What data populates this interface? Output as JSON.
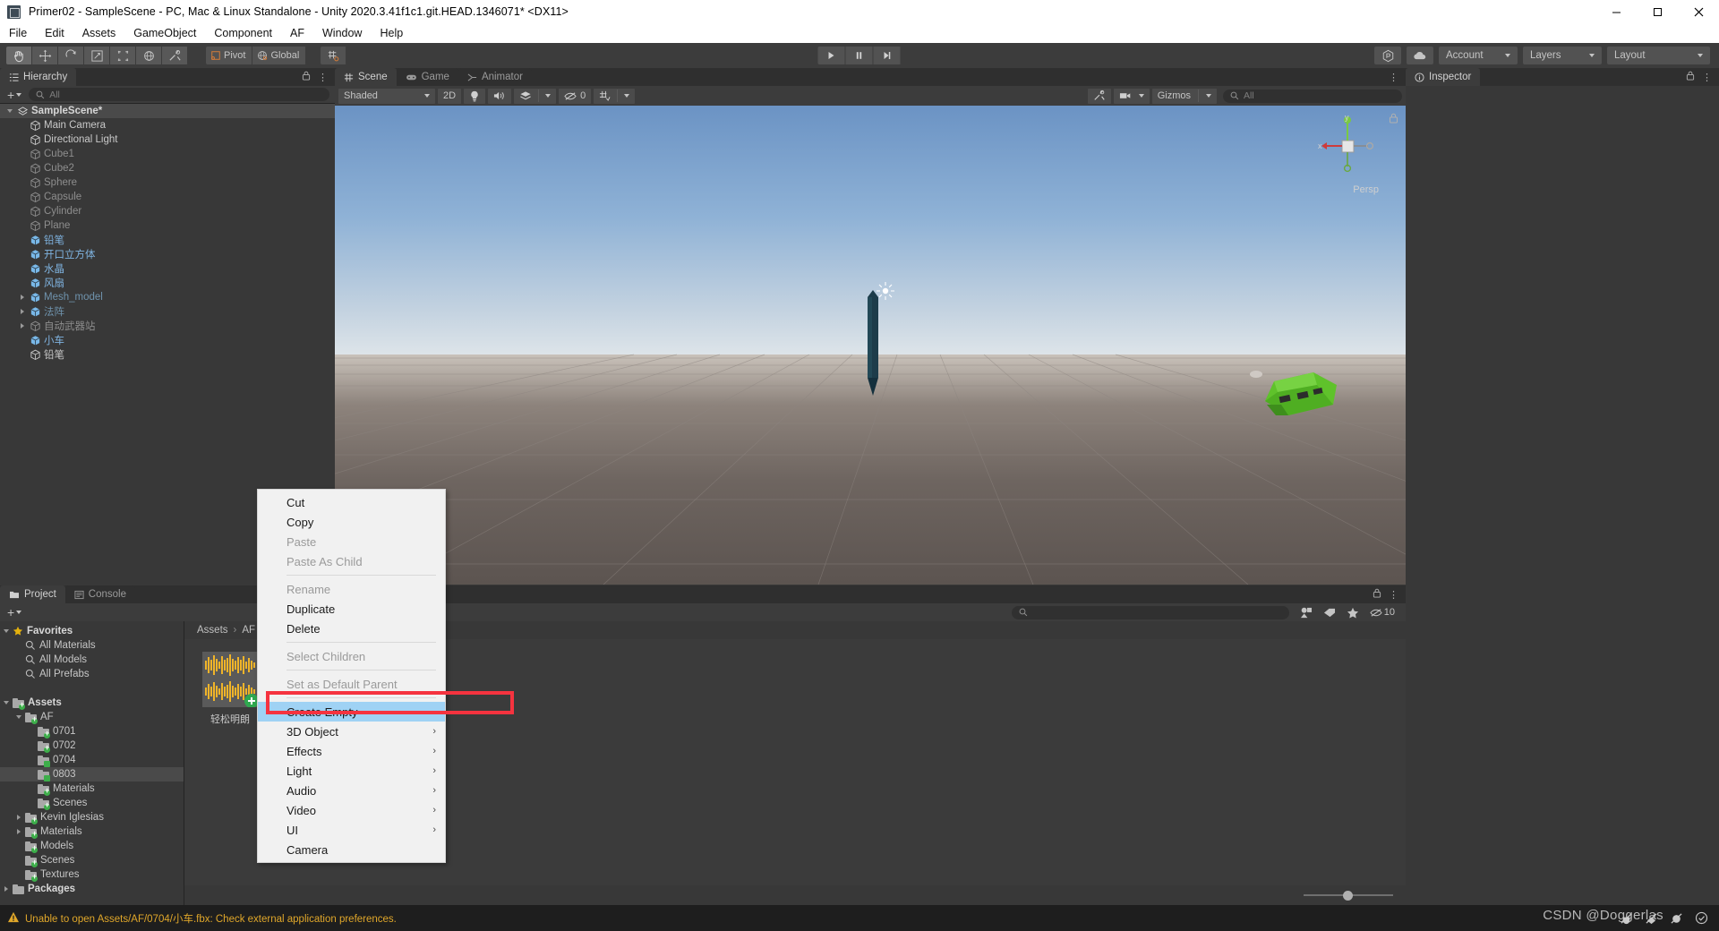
{
  "window": {
    "title": "Primer02 - SampleScene - PC, Mac & Linux Standalone - Unity 2020.3.41f1c1.git.HEAD.1346071* <DX11>",
    "minimize": "–",
    "maximize": "☐",
    "close": "✕"
  },
  "menubar": {
    "items": [
      "File",
      "Edit",
      "Assets",
      "GameObject",
      "Component",
      "AF",
      "Window",
      "Help"
    ]
  },
  "toolbar": {
    "tools": [
      "hand-tool",
      "move-tool",
      "rotate-tool",
      "scale-tool",
      "rect-tool",
      "transform-tool",
      "custom-tool"
    ],
    "pivot_label": "Pivot",
    "global_label": "Global",
    "grid_label": "grid-snap",
    "play": "▶",
    "pause": "‖",
    "step": "▶|",
    "collab_label": "collab-icon",
    "cloud_label": "cloud-icon",
    "account_label": "Account",
    "layers_label": "Layers",
    "layout_label": "Layout"
  },
  "hierarchy": {
    "tab_label": "Hierarchy",
    "search_placeholder": "All",
    "add_label": "+",
    "items": [
      {
        "label": "SampleScene*",
        "depth": 0,
        "style": "bold",
        "twisty": "open",
        "icon": "scene-icon",
        "selected": true
      },
      {
        "label": "Main Camera",
        "depth": 1,
        "style": "normal",
        "twisty": "none",
        "icon": "gameobject-icon"
      },
      {
        "label": "Directional Light",
        "depth": 1,
        "style": "normal",
        "twisty": "none",
        "icon": "gameobject-icon"
      },
      {
        "label": "Cube1",
        "depth": 1,
        "style": "dim",
        "twisty": "none",
        "icon": "gameobject-icon"
      },
      {
        "label": "Cube2",
        "depth": 1,
        "style": "dim",
        "twisty": "none",
        "icon": "gameobject-icon"
      },
      {
        "label": "Sphere",
        "depth": 1,
        "style": "dim",
        "twisty": "none",
        "icon": "gameobject-icon"
      },
      {
        "label": "Capsule",
        "depth": 1,
        "style": "dim",
        "twisty": "none",
        "icon": "gameobject-icon"
      },
      {
        "label": "Cylinder",
        "depth": 1,
        "style": "dim",
        "twisty": "none",
        "icon": "gameobject-icon"
      },
      {
        "label": "Plane",
        "depth": 1,
        "style": "dim",
        "twisty": "none",
        "icon": "gameobject-icon"
      },
      {
        "label": "铅笔",
        "depth": 1,
        "style": "blue",
        "twisty": "none",
        "icon": "prefab-icon"
      },
      {
        "label": "开口立方体",
        "depth": 1,
        "style": "blue",
        "twisty": "none",
        "icon": "prefab-icon"
      },
      {
        "label": "水晶",
        "depth": 1,
        "style": "blue",
        "twisty": "none",
        "icon": "prefab-icon"
      },
      {
        "label": "风扇",
        "depth": 1,
        "style": "blue",
        "twisty": "none",
        "icon": "prefab-icon"
      },
      {
        "label": "Mesh_model",
        "depth": 1,
        "style": "bluedim",
        "twisty": "closed",
        "icon": "prefab-icon"
      },
      {
        "label": "法阵",
        "depth": 1,
        "style": "bluedim",
        "twisty": "closed",
        "icon": "prefab-icon"
      },
      {
        "label": "自动武器站",
        "depth": 1,
        "style": "dim",
        "twisty": "closed",
        "icon": "gameobject-icon"
      },
      {
        "label": "小车",
        "depth": 1,
        "style": "blue",
        "twisty": "none",
        "icon": "prefab-icon"
      },
      {
        "label": "铅笔",
        "depth": 1,
        "style": "normal",
        "twisty": "none",
        "icon": "gameobject-icon"
      }
    ]
  },
  "scene": {
    "tabs": [
      {
        "label": "Scene",
        "icon": "scene-grid-icon",
        "active": true
      },
      {
        "label": "Game",
        "icon": "gamepad-icon",
        "active": false
      },
      {
        "label": "Animator",
        "icon": "animator-icon",
        "active": false
      }
    ],
    "draw_mode": "Shaded",
    "mode_2d": "2D",
    "lighting_icon": "lightbulb-icon",
    "audio_icon": "speaker-icon",
    "fx_icon": "effects-icon",
    "hidden_count": "0",
    "grid_icon": "grid-visibility-icon",
    "tools_icon": "scene-tools-icon",
    "camera_icon": "scene-camera-icon",
    "gizmos_label": "Gizmos",
    "search_placeholder": "All",
    "persp_label": "Persp",
    "gizmo_axes": {
      "x": "x",
      "y": "y",
      "z": "z"
    }
  },
  "inspector": {
    "tab_label": "Inspector",
    "icon": "info-icon"
  },
  "project": {
    "tabs": [
      {
        "label": "Project",
        "icon": "folder-icon",
        "active": true
      },
      {
        "label": "Console",
        "icon": "console-icon",
        "active": false
      }
    ],
    "add_label": "+",
    "search_placeholder": "",
    "hidden_count": "10",
    "breadcrumb": [
      "Assets",
      "AF"
    ],
    "tree": [
      {
        "label": "Favorites",
        "depth": 0,
        "twisty": "open",
        "icon": "star-icon",
        "bold": true
      },
      {
        "label": "All Materials",
        "depth": 1,
        "twisty": "none",
        "icon": "search-icon"
      },
      {
        "label": "All Models",
        "depth": 1,
        "twisty": "none",
        "icon": "search-icon"
      },
      {
        "label": "All Prefabs",
        "depth": 1,
        "twisty": "none",
        "icon": "search-icon"
      },
      {
        "label": "",
        "depth": 0,
        "twisty": "none",
        "icon": "spacer"
      },
      {
        "label": "Assets",
        "depth": 0,
        "twisty": "open",
        "icon": "folder-icon",
        "bold": true
      },
      {
        "label": "AF",
        "depth": 1,
        "twisty": "open",
        "icon": "folder-icon"
      },
      {
        "label": "0701",
        "depth": 2,
        "twisty": "none",
        "icon": "folder-icon"
      },
      {
        "label": "0702",
        "depth": 2,
        "twisty": "none",
        "icon": "folder-icon"
      },
      {
        "label": "0704",
        "depth": 2,
        "twisty": "none",
        "icon": "folder-script-icon"
      },
      {
        "label": "0803",
        "depth": 2,
        "twisty": "none",
        "icon": "folder-script-icon",
        "selected": true
      },
      {
        "label": "Materials",
        "depth": 2,
        "twisty": "none",
        "icon": "folder-icon"
      },
      {
        "label": "Scenes",
        "depth": 2,
        "twisty": "none",
        "icon": "folder-icon"
      },
      {
        "label": "Kevin Iglesias",
        "depth": 1,
        "twisty": "closed",
        "icon": "folder-icon"
      },
      {
        "label": "Materials",
        "depth": 1,
        "twisty": "closed",
        "icon": "folder-icon"
      },
      {
        "label": "Models",
        "depth": 1,
        "twisty": "none",
        "icon": "folder-icon"
      },
      {
        "label": "Scenes",
        "depth": 1,
        "twisty": "none",
        "icon": "folder-icon"
      },
      {
        "label": "Textures",
        "depth": 1,
        "twisty": "none",
        "icon": "folder-icon"
      },
      {
        "label": "Packages",
        "depth": 0,
        "twisty": "closed",
        "icon": "folder-plain-icon",
        "bold": true
      }
    ],
    "assets": [
      {
        "label": "轻松明朗",
        "type": "audioclip"
      }
    ]
  },
  "context_menu": {
    "items": [
      {
        "label": "Cut",
        "enabled": true,
        "submenu": false
      },
      {
        "label": "Copy",
        "enabled": true,
        "submenu": false
      },
      {
        "label": "Paste",
        "enabled": false,
        "submenu": false
      },
      {
        "label": "Paste As Child",
        "enabled": false,
        "submenu": false
      },
      {
        "separator": true
      },
      {
        "label": "Rename",
        "enabled": false,
        "submenu": false
      },
      {
        "label": "Duplicate",
        "enabled": true,
        "submenu": false
      },
      {
        "label": "Delete",
        "enabled": true,
        "submenu": false
      },
      {
        "separator": true
      },
      {
        "label": "Select Children",
        "enabled": false,
        "submenu": false
      },
      {
        "separator": true
      },
      {
        "label": "Set as Default Parent",
        "enabled": false,
        "submenu": false
      },
      {
        "separator": true
      },
      {
        "label": "Create Empty",
        "enabled": true,
        "submenu": false,
        "highlighted": true
      },
      {
        "label": "3D Object",
        "enabled": true,
        "submenu": true
      },
      {
        "label": "Effects",
        "enabled": true,
        "submenu": true
      },
      {
        "label": "Light",
        "enabled": true,
        "submenu": true
      },
      {
        "label": "Audio",
        "enabled": true,
        "submenu": true
      },
      {
        "label": "Video",
        "enabled": true,
        "submenu": true
      },
      {
        "label": "UI",
        "enabled": true,
        "submenu": true
      },
      {
        "label": "Camera",
        "enabled": true,
        "submenu": false
      }
    ],
    "submenu_arrow": "›"
  },
  "statusbar": {
    "message": "Unable to open Assets/AF/0704/小车.fbx: Check external application preferences.",
    "warning_icon": "warning-triangle-icon",
    "icons": [
      "bug-mute-icon",
      "log-mute-icon",
      "error-mute-icon",
      "check-circle-icon"
    ]
  },
  "watermark": "CSDN @Doggerlas",
  "colors": {
    "panel_bg": "#383838",
    "toolbar_bg": "#3c3c3c",
    "tab_inactive": "#2f2f2f",
    "accent_highlight": "#9fd2f4",
    "highlight_box": "#f5333f",
    "status_warning": "#e0a72a",
    "hierarchy_prefab": "#7fb3e0",
    "car_green": "#5fc22b"
  }
}
